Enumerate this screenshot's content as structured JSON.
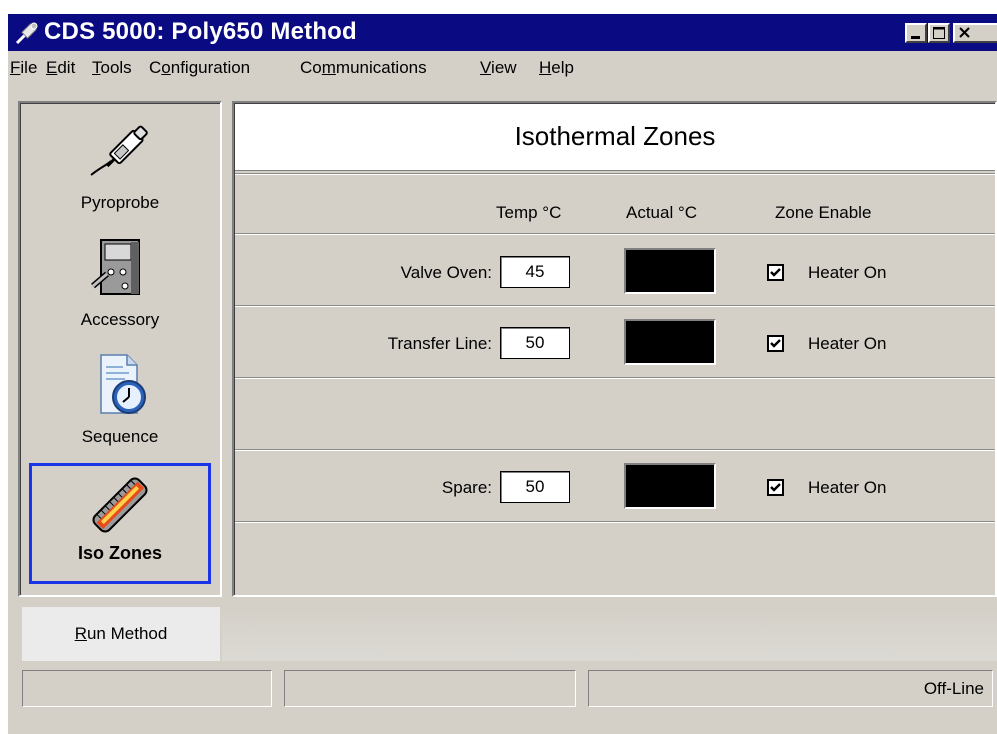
{
  "window": {
    "title": "CDS 5000: Poly650 Method"
  },
  "menu": [
    {
      "label": "File",
      "key": "F",
      "rest": "ile"
    },
    {
      "label": "Edit",
      "key": "E",
      "rest": "dit"
    },
    {
      "label": "Tools",
      "key": "T",
      "rest": "ools"
    },
    {
      "label": "Configuration",
      "pre": "C",
      "key": "o",
      "rest": "nfiguration"
    },
    {
      "label": "Communications",
      "pre": "Co",
      "key": "m",
      "rest": "munications"
    },
    {
      "label": "View",
      "key": "V",
      "rest": "iew"
    },
    {
      "label": "Help",
      "key": "H",
      "rest": "elp"
    }
  ],
  "sidebar": {
    "items": [
      {
        "label": "Pyroprobe",
        "icon": "pyroprobe-icon"
      },
      {
        "label": "Accessory",
        "icon": "accessory-icon"
      },
      {
        "label": "Sequence",
        "icon": "sequence-icon"
      },
      {
        "label": "Iso Zones",
        "icon": "iso-zones-icon",
        "selected": true
      }
    ],
    "selected_border_color": "#1a34e6"
  },
  "panel": {
    "title": "Isothermal Zones",
    "columns": {
      "temp": "Temp °C",
      "actual": "Actual °C",
      "enable": "Zone Enable"
    },
    "zones": [
      {
        "label": "Valve Oven:",
        "temp": "45",
        "heater_label": "Heater On",
        "heater_on": true
      },
      {
        "label": "Transfer Line:",
        "temp": "50",
        "heater_label": "Heater On",
        "heater_on": true
      },
      {
        "label": "Spare:",
        "temp": "50",
        "heater_label": "Heater On",
        "heater_on": true
      }
    ]
  },
  "run_button": {
    "pre": "",
    "key": "R",
    "rest": "un Method"
  },
  "status": {
    "panels": [
      "",
      "",
      "Off-Line"
    ]
  },
  "colors": {
    "titlebar": "#0a0a82",
    "face": "#d4d0c8",
    "actual_display": "#000000"
  }
}
